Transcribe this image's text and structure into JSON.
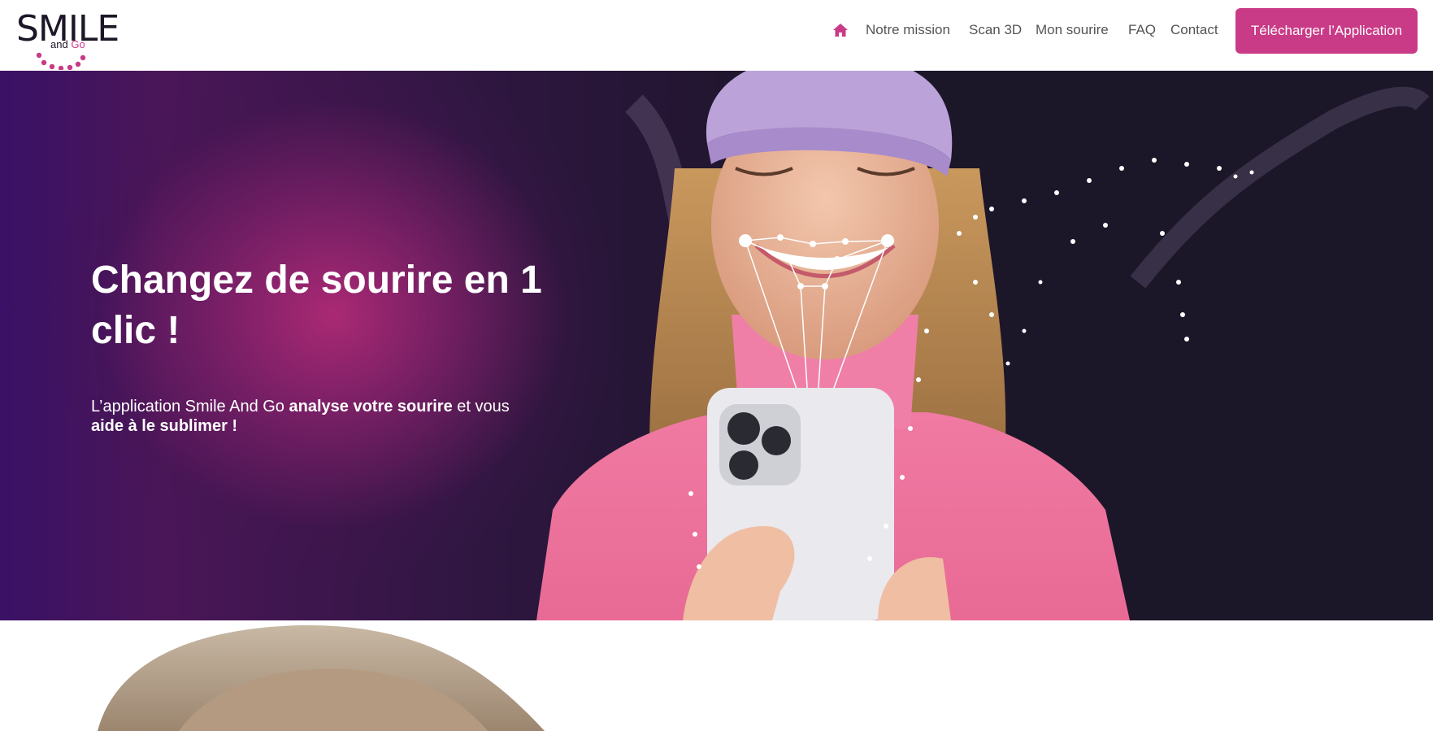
{
  "header": {
    "logo": {
      "main": "SMILE",
      "sub_and": "and",
      "sub_go": "Go"
    },
    "nav": [
      {
        "label": "Notre mission"
      },
      {
        "label": "Scan 3D"
      },
      {
        "label": "Mon sourire"
      },
      {
        "label": "FAQ"
      },
      {
        "label": "Contact"
      }
    ],
    "home_icon": "home-icon",
    "cta_label": "Télécharger l’Application"
  },
  "hero": {
    "title": "Changez de sourire en 1 clic !",
    "subtitle_part1": "L’application Smile And Go ",
    "subtitle_bold1": "analyse votre sourire",
    "subtitle_part2": " et vous ",
    "subtitle_bold2": "aide à le sublimer !"
  },
  "colors": {
    "brand": "#c93a87",
    "dark": "#1c1629",
    "text_nav": "#545454"
  }
}
